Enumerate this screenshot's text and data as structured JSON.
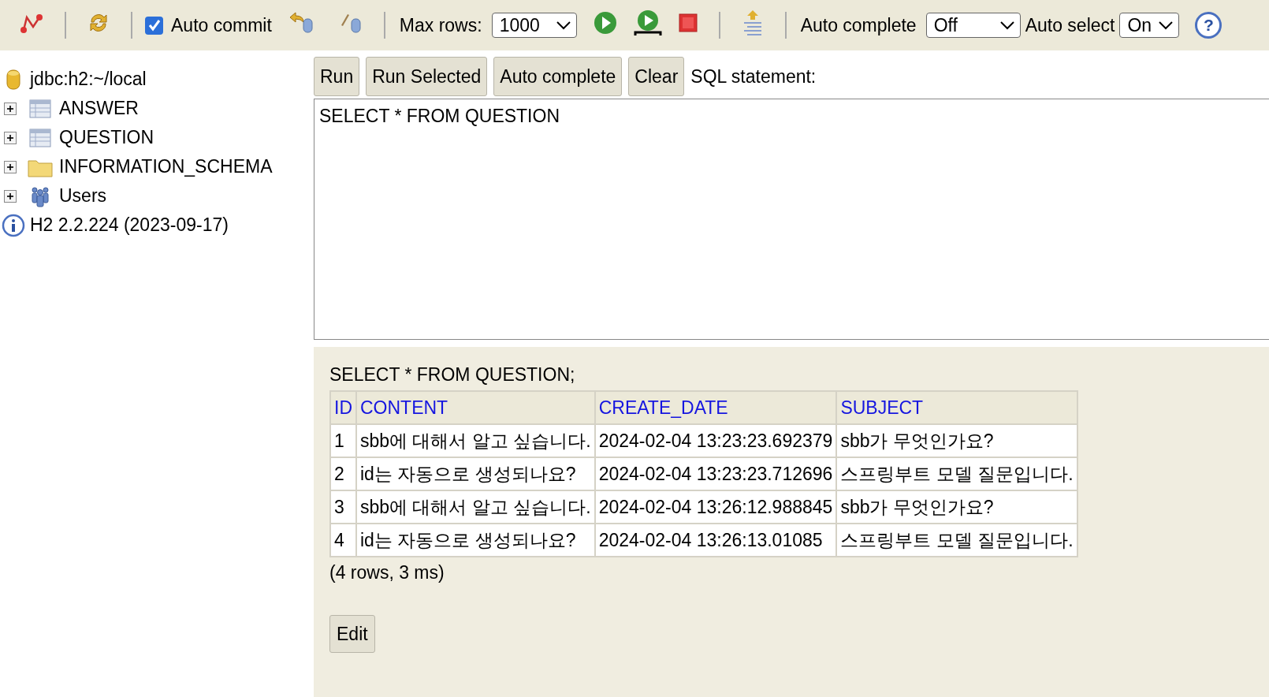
{
  "toolbar": {
    "auto_commit": {
      "label": "Auto commit",
      "checked": true
    },
    "max_rows": {
      "label": "Max rows:",
      "value": "1000"
    },
    "auto_complete": {
      "label": "Auto complete",
      "value": "Off"
    },
    "auto_select": {
      "label": "Auto select",
      "value": "On"
    },
    "help": "?"
  },
  "tree": {
    "items": [
      {
        "kind": "database",
        "label": "jdbc:h2:~/local"
      },
      {
        "kind": "table",
        "label": "ANSWER",
        "expanded": false
      },
      {
        "kind": "table",
        "label": "QUESTION",
        "expanded": false
      },
      {
        "kind": "folder",
        "label": "INFORMATION_SCHEMA",
        "expanded": false
      },
      {
        "kind": "users",
        "label": "Users",
        "expanded": false
      },
      {
        "kind": "info",
        "label": "H2 2.2.224 (2023-09-17)"
      }
    ]
  },
  "query": {
    "buttons": [
      "Run",
      "Run Selected",
      "Auto complete",
      "Clear"
    ],
    "label": "SQL statement:",
    "value": "SELECT * FROM QUESTION"
  },
  "result": {
    "statement": "SELECT * FROM QUESTION;",
    "table": {
      "columns": [
        "ID",
        "CONTENT",
        "CREATE_DATE",
        "SUBJECT"
      ],
      "rows": [
        [
          "1",
          "sbb에 대해서 알고 싶습니다.",
          "2024-02-04 13:23:23.692379",
          "sbb가 무엇인가요?"
        ],
        [
          "2",
          "id는 자동으로 생성되나요?",
          "2024-02-04 13:23:23.712696",
          "스프링부트 모델 질문입니다."
        ],
        [
          "3",
          "sbb에 대해서 알고 싶습니다.",
          "2024-02-04 13:26:12.988845",
          "sbb가 무엇인가요?"
        ],
        [
          "4",
          "id는 자동으로 생성되나요?",
          "2024-02-04 13:26:13.01085",
          "스프링부트 모델 질문입니다."
        ]
      ]
    },
    "footer": "(4 rows, 3 ms)",
    "edit_button": "Edit"
  }
}
